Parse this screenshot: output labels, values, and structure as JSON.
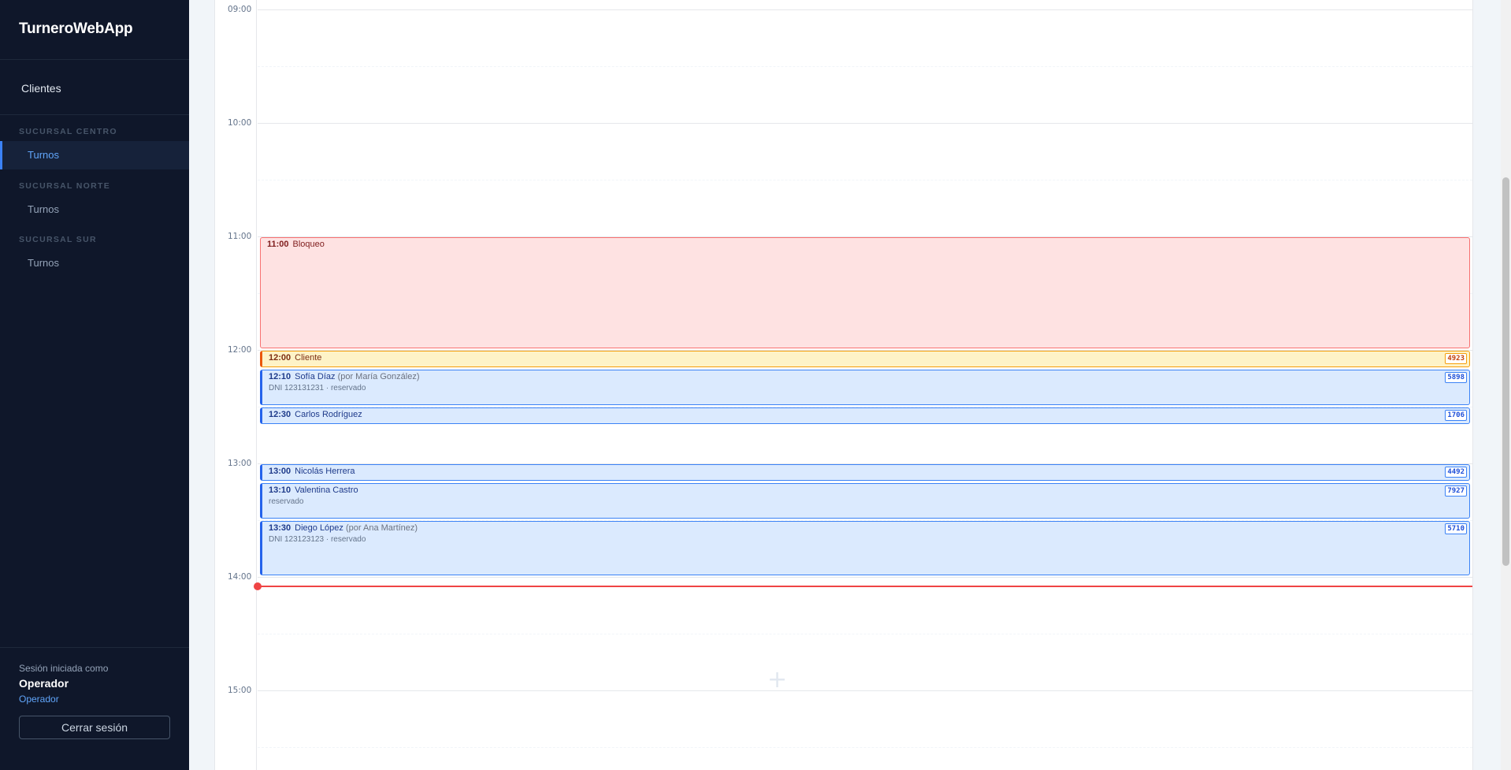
{
  "app": {
    "title": "TurneroWebApp"
  },
  "sidebar": {
    "clientes_label": "Clientes",
    "branches": [
      {
        "title": "SUCURSAL CENTRO",
        "item_label": "Turnos",
        "active": true
      },
      {
        "title": "SUCURSAL NORTE",
        "item_label": "Turnos",
        "active": false
      },
      {
        "title": "SUCURSAL SUR",
        "item_label": "Turnos",
        "active": false
      }
    ],
    "session": {
      "label": "Sesión iniciada como",
      "user": "Operador",
      "role": "Operador",
      "logout_label": "Cerrar sesión"
    }
  },
  "calendar": {
    "hours": [
      "09:00",
      "10:00",
      "11:00",
      "12:00",
      "13:00",
      "14:00",
      "15:00"
    ],
    "events": [
      {
        "time": "11:00",
        "title": "Bloqueo",
        "kind": "block"
      },
      {
        "time": "12:00",
        "title": "Cliente",
        "code": "4923",
        "kind": "pending"
      },
      {
        "time": "12:10",
        "title": "Sofía Díaz",
        "by": "(por María González)",
        "detail": "DNI 123131231 · reservado",
        "code": "5898",
        "kind": "booked"
      },
      {
        "time": "12:30",
        "title": "Carlos Rodríguez",
        "code": "1706",
        "kind": "booked"
      },
      {
        "time": "13:00",
        "title": "Nicolás Herrera",
        "code": "4492",
        "kind": "booked"
      },
      {
        "time": "13:10",
        "title": "Valentina Castro",
        "detail": "reservado",
        "code": "7927",
        "kind": "booked"
      },
      {
        "time": "13:30",
        "title": "Diego López",
        "by": "(por Ana Martínez)",
        "detail": "DNI 123123123 · reservado",
        "code": "5710",
        "kind": "booked"
      }
    ],
    "colors": {
      "now_line": "#ef4444",
      "block": "#fee2e2",
      "pending": "#fef3c7",
      "booked": "#dbeafe"
    }
  }
}
